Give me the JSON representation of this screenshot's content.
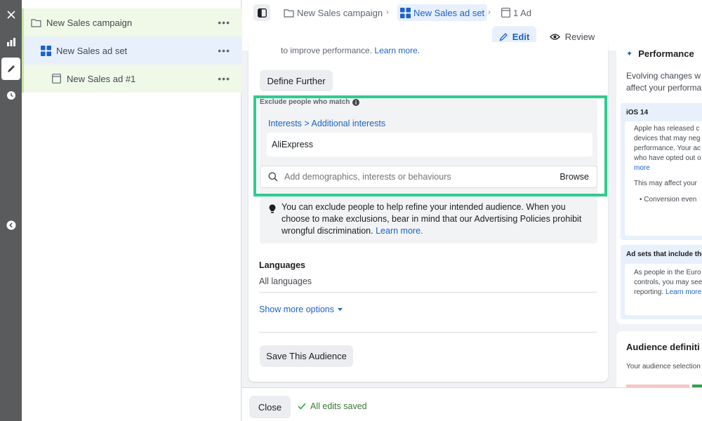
{
  "rail": {
    "close_glyph": "✕",
    "collapse_glyph": "‹"
  },
  "tree": {
    "campaign": {
      "label": "New Sales campaign",
      "more": "•••"
    },
    "adset": {
      "label": "New Sales ad set",
      "more": "•••"
    },
    "ad": {
      "label": "New Sales ad #1",
      "more": "•••"
    }
  },
  "breadcrumb": {
    "campaign": "New Sales campaign",
    "adset": "New Sales ad set",
    "ad": "1 Ad",
    "separator": "›"
  },
  "mode": {
    "edit_label": "Edit",
    "review_label": "Review"
  },
  "main": {
    "top_partial_text": "to improve performance.",
    "top_partial_link": "Learn more.",
    "define_further_label": "Define Further",
    "exclude": {
      "title": "Exclude people who match",
      "category_path": "Interests > Additional interests",
      "selected_item": "AliExpress",
      "search_placeholder": "Add demographics, interests or behaviours",
      "browse_label": "Browse"
    },
    "tip": {
      "text": "You can exclude people to help refine your intended audience. When you choose to make exclusions, bear in mind that our Advertising Policies prohibit wrongful discrimination.",
      "link": "Learn more."
    },
    "languages": {
      "label": "Languages",
      "value": "All languages"
    },
    "show_more_label": "Show more options",
    "save_audience_label": "Save This Audience"
  },
  "right": {
    "performance_title": "Performance",
    "evolving_text_1": "Evolving changes w",
    "evolving_text_2": "affect your performa",
    "ios_title": "iOS 14",
    "ios_lines": [
      "Apple has released c",
      "devices that may neg",
      "performance. Your ac",
      "who have opted out o"
    ],
    "ios_more": "more",
    "may_affect": "This may affect your",
    "bullet": "Conversion even",
    "adsets_title": "Ad sets that include the",
    "adsets_lines": [
      "As people in the Euro",
      "controls, you may see",
      "reporting."
    ],
    "adsets_learn": "Learn more",
    "audience_def_title": "Audience definiti",
    "audience_def_text": "Your audience selection"
  },
  "footer": {
    "close_label": "Close",
    "saved_label": "All edits saved"
  },
  "colors": {
    "accent": "#1b63c7",
    "highlight": "#2ecc8f",
    "tree_selected": "#e7f0fb",
    "tree_hover": "#f0f8e8",
    "success": "#31a24c"
  }
}
